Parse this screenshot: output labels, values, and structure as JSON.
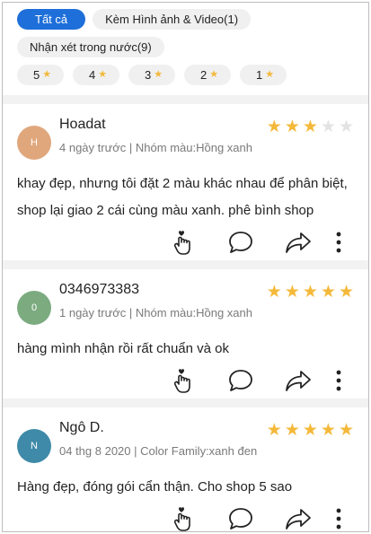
{
  "filters": {
    "row1": [
      {
        "label": "Tất cả",
        "active": true
      },
      {
        "label": "Kèm Hình ảnh & Video(1)",
        "active": false
      }
    ],
    "row2": [
      {
        "label": "Nhận xét trong nước(9)",
        "active": false
      }
    ],
    "stars": [
      "5",
      "4",
      "3",
      "2",
      "1"
    ]
  },
  "colors": {
    "accent": "#1e6fd9",
    "star": "#f4b93a",
    "star_empty": "#e3e3e3"
  },
  "reviews": [
    {
      "initial": "H",
      "avatar_color": "#e0a77d",
      "name": "Hoadat",
      "rating": 3,
      "meta": "4 ngày trước | Nhóm màu:Hồng xanh",
      "text": "khay đẹp, nhưng tôi đặt 2 màu khác nhau để phân biệt, shop lại giao 2 cái cùng màu xanh. phê bình shop"
    },
    {
      "initial": "0",
      "avatar_color": "#7cab80",
      "name": "0346973383",
      "rating": 5,
      "meta": "1 ngày trước | Nhóm màu:Hồng xanh",
      "text": "hàng mình nhận rồi rất chuẩn và ok"
    },
    {
      "initial": "N",
      "avatar_color": "#3f8aa8",
      "name": "Ngô D.",
      "rating": 5,
      "meta": "04 thg 8 2020 | Color Family:xanh đen",
      "text": "Hàng đẹp, đóng gói cẩn thận. Cho shop 5 sao"
    }
  ],
  "icons": [
    "like-hand-icon",
    "comment-icon",
    "share-icon",
    "more-options-icon"
  ]
}
